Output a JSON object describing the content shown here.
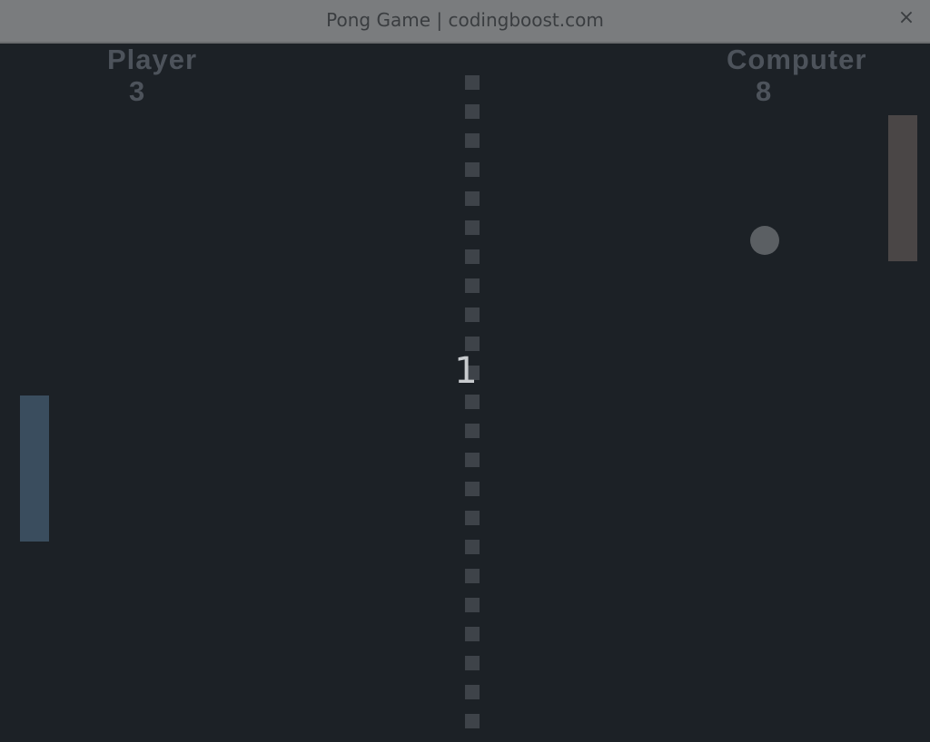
{
  "window": {
    "title": "Pong Game | codingboost.com",
    "close_glyph": "×"
  },
  "scoreboard": {
    "player_label": "Player",
    "player_score": "3",
    "computer_label": "Computer",
    "computer_score": "8"
  },
  "countdown": "1",
  "colors": {
    "background": "#1c2126",
    "titlebar": "#7a7c7e",
    "score_text": "#4d535b",
    "net": "#3e4349",
    "player_paddle": "#3a4d5e",
    "computer_paddle": "#4a4646",
    "ball": "#5b5f63",
    "countdown_text": "#c8cbce"
  },
  "icons": {
    "close": "close-icon"
  }
}
